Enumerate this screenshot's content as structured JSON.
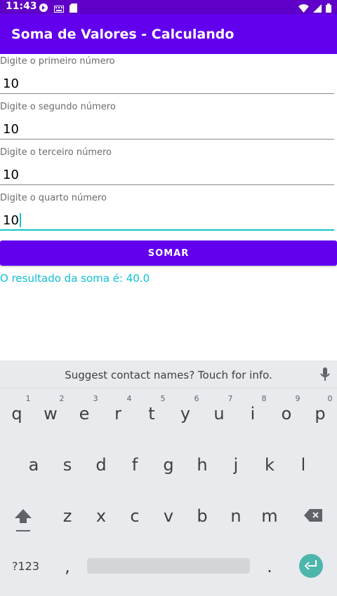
{
  "status_bar": {
    "time": "11:43",
    "icons_left": [
      "sync-icon",
      "keyboard-icon",
      "sd-card-icon"
    ],
    "icons_right": [
      "wifi-icon",
      "signal-icon",
      "battery-icon"
    ]
  },
  "app_bar": {
    "title": "Soma de Valores - Calculando"
  },
  "fields": [
    {
      "label": "Digite o primeiro número",
      "value": "10"
    },
    {
      "label": "Digite o segundo número",
      "value": "10"
    },
    {
      "label": "Digite o terceiro número",
      "value": "10"
    },
    {
      "label": "Digite o quarto número",
      "value": "10"
    }
  ],
  "button": {
    "label": "SOMAR"
  },
  "result": {
    "text": "O resultado da soma é: 40.0"
  },
  "keyboard": {
    "suggestion": "Suggest contact names? Touch for info.",
    "row1": [
      "q",
      "w",
      "e",
      "r",
      "t",
      "y",
      "u",
      "i",
      "o",
      "p"
    ],
    "row1_hints": [
      "1",
      "2",
      "3",
      "4",
      "5",
      "6",
      "7",
      "8",
      "9",
      "0"
    ],
    "row2": [
      "a",
      "s",
      "d",
      "f",
      "g",
      "h",
      "j",
      "k",
      "l"
    ],
    "row3": [
      "z",
      "x",
      "c",
      "v",
      "b",
      "n",
      "m"
    ],
    "symbols_label": "?123",
    "comma": ",",
    "period": "."
  },
  "colors": {
    "primary": "#6200ee",
    "status_bar": "#5f00c8",
    "accent": "#12c6c9",
    "result": "#0ebfd6",
    "enter_key": "#4db6ac"
  }
}
